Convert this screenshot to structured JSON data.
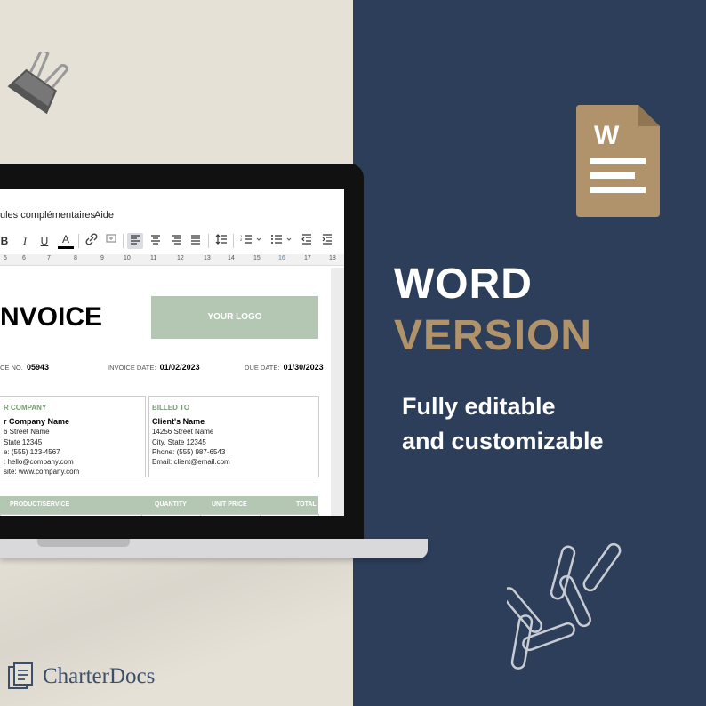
{
  "headline": {
    "line1": "WORD",
    "line2": "VERSION"
  },
  "subline": {
    "line1": "Fully editable",
    "line2": "and customizable"
  },
  "brand": {
    "name": "CharterDocs"
  },
  "word_icon": {
    "letter": "W",
    "color": "#b0936a"
  },
  "colors": {
    "navy": "#2c3e5a",
    "beige": "#e6e1d7",
    "gold": "#b0936a",
    "sage": "#b3c7b2"
  },
  "editor": {
    "menu": {
      "addons": "ules complémentaires",
      "help": "Aide"
    },
    "toolbar": {
      "bold": "B",
      "italic": "I",
      "underline": "U",
      "text_color": "A"
    },
    "ruler": [
      "5",
      "6",
      "7",
      "8",
      "9",
      "10",
      "11",
      "12",
      "13",
      "14",
      "15",
      "16",
      "17",
      "18"
    ]
  },
  "invoice": {
    "title": "NVOICE",
    "logo": "YOUR LOGO",
    "invoice_no_label": "CE NO.",
    "invoice_no": "05943",
    "invoice_date_label": "INVOICE DATE:",
    "invoice_date": "01/02/2023",
    "due_date_label": "DUE DATE:",
    "due_date": "01/30/2023",
    "company": {
      "label": "R COMPANY",
      "name": "r Company Name",
      "lines": [
        "6 Street Name",
        "State 12345",
        "e: (555) 123-4567",
        ": hello@company.com",
        "site: www.company.com"
      ]
    },
    "billed": {
      "label": "BILLED TO",
      "name": "Client's Name",
      "lines": [
        "14256 Street Name",
        "City, State 12345",
        "Phone: (555) 987-6543",
        "Email: client@email.com"
      ]
    },
    "table_headers": {
      "product": "PRODUCT/SERVICE",
      "quantity": "QUANTITY",
      "unit_price": "UNIT PRICE",
      "total": "TOTAL"
    }
  }
}
